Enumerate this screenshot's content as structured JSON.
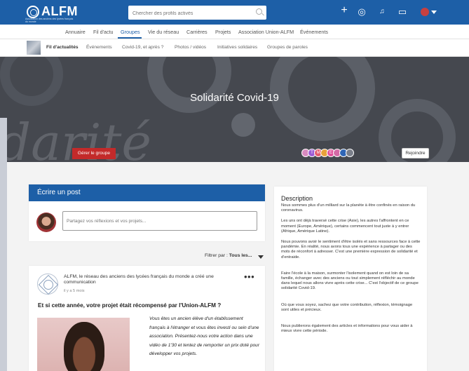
{
  "topbar": {
    "logo": "ALFM",
    "logo_sub": "Association des anciens des lycées français du monde",
    "search_placeholder": "Chercher des profils activés",
    "icons": [
      "plus-icon",
      "location-pin-icon",
      "bell-icon",
      "chat-icon",
      "avatar",
      "chevron-down-icon"
    ],
    "plus_glyph": "+",
    "pin_glyph": "◎",
    "bell_glyph": "♫",
    "chat_glyph": "▭"
  },
  "mainnav": {
    "items": [
      "Annuaire",
      "Fil d'actu",
      "Groupes",
      "Vie du réseau",
      "Carrières",
      "Projets",
      "Association Union-ALFM",
      "Événements"
    ],
    "active": "Groupes",
    "accent": "#1d5fa7"
  },
  "subnav": {
    "items": [
      "Fil d'actualités",
      "Événements",
      "Covid-19, et après ?",
      "Photos / vidéos",
      "Initiatives solidaires",
      "Groupes de paroles"
    ],
    "active": "Fil d'actualités"
  },
  "banner": {
    "title": "Solidarité Covid-19",
    "script_text": "darité",
    "manage_label": "Gérer le groupe",
    "join_label": "Rejoindre",
    "member_initials": [
      "",
      "T",
      "M",
      "",
      "E",
      "",
      "",
      ""
    ],
    "member_colors": [
      "#d98bc0",
      "#9c5bd4",
      "#e35b6d",
      "#e8a13a",
      "#e0509a",
      "#d46aa6",
      "#2f66b6",
      "#7a7f8a"
    ],
    "button_color": "#c32a2a"
  },
  "post": {
    "header": "Écrire un post",
    "placeholder": "Partagez vos réflexions et vos projets..."
  },
  "filter": {
    "label": "Filtrer par :",
    "value": "Tous les..."
  },
  "feed": {
    "author": "ALFM, le réseau des anciens des lycées français du monde a créé une communication",
    "time": "il y a 5 mois",
    "more": "•••",
    "title": "Et si cette année, votre projet était récompensé par l'Union-ALFM ?",
    "body": "Vous êtes un ancien élève d'un établissement français à l'étranger et vous êtes investi ou sein d'une association. Présentez-nous votre action dans une vidéo de 1'30 et tentez de remporter un prix doté pour développer vos projets."
  },
  "description": {
    "title": "Description",
    "paragraphs": [
      "Nous sommes plus d'un milliard sur la planète à être confinés en raison du coronavirus.",
      "Les uns ont déjà traversé cette crise (Asie), les autres l'affrontent en ce moment (Europe, Amérique), certains commencent tout juste à y entrer (Afrique, Amérique Latine).",
      "Nous pouvons avoir le sentiment d'être isolés et sans ressources face à cette pandémie. En réalité, nous avons tous une expérience à partager ou des mots de réconfort à adresser. C'est une première expression de solidarité et d'entraide.",
      "Faire l'école à la maison, surmonter l'isolement quand on est loin de sa famille, échanger avec des anciens ou tout simplement réfléchir au monde dans lequel nous allons vivre après cette crise... C'est l'objectif de ce groupe solidarité Covid-19.",
      "Où que vous soyez, sachez que votre contribution, réflexion, témoignage sont utiles et précieux.",
      "Nous publierons également des articles et informations pour vous aider à mieux vivre cette période."
    ]
  }
}
